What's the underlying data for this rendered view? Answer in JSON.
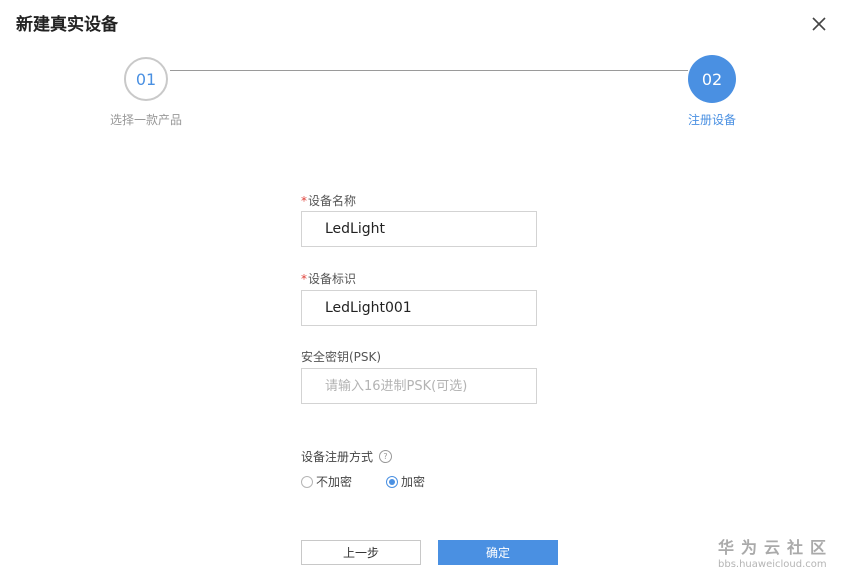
{
  "dialog": {
    "title": "新建真实设备"
  },
  "stepper": {
    "steps": [
      {
        "number": "01",
        "label": "选择一款产品",
        "state": "done"
      },
      {
        "number": "02",
        "label": "注册设备",
        "state": "active"
      }
    ]
  },
  "form": {
    "device_name": {
      "required": true,
      "required_mark": "*",
      "label": "设备名称",
      "value": "LedLight"
    },
    "device_id": {
      "required": true,
      "required_mark": "*",
      "label": "设备标识",
      "value": "LedLight001"
    },
    "psk": {
      "label": "安全密钥(PSK)",
      "value": "",
      "placeholder": "请输入16进制PSK(可选)"
    },
    "registration": {
      "label": "设备注册方式",
      "help_icon": "question-circle-icon",
      "help_glyph": "?",
      "options": [
        {
          "label": "不加密",
          "checked": false
        },
        {
          "label": "加密",
          "checked": true
        }
      ]
    }
  },
  "buttons": {
    "prev": "上一步",
    "ok": "确定"
  },
  "watermark": {
    "title": "华为云社区",
    "url": "bbs.huaweicloud.com"
  },
  "colors": {
    "accent": "#4a90e2",
    "required": "#e0433b"
  }
}
